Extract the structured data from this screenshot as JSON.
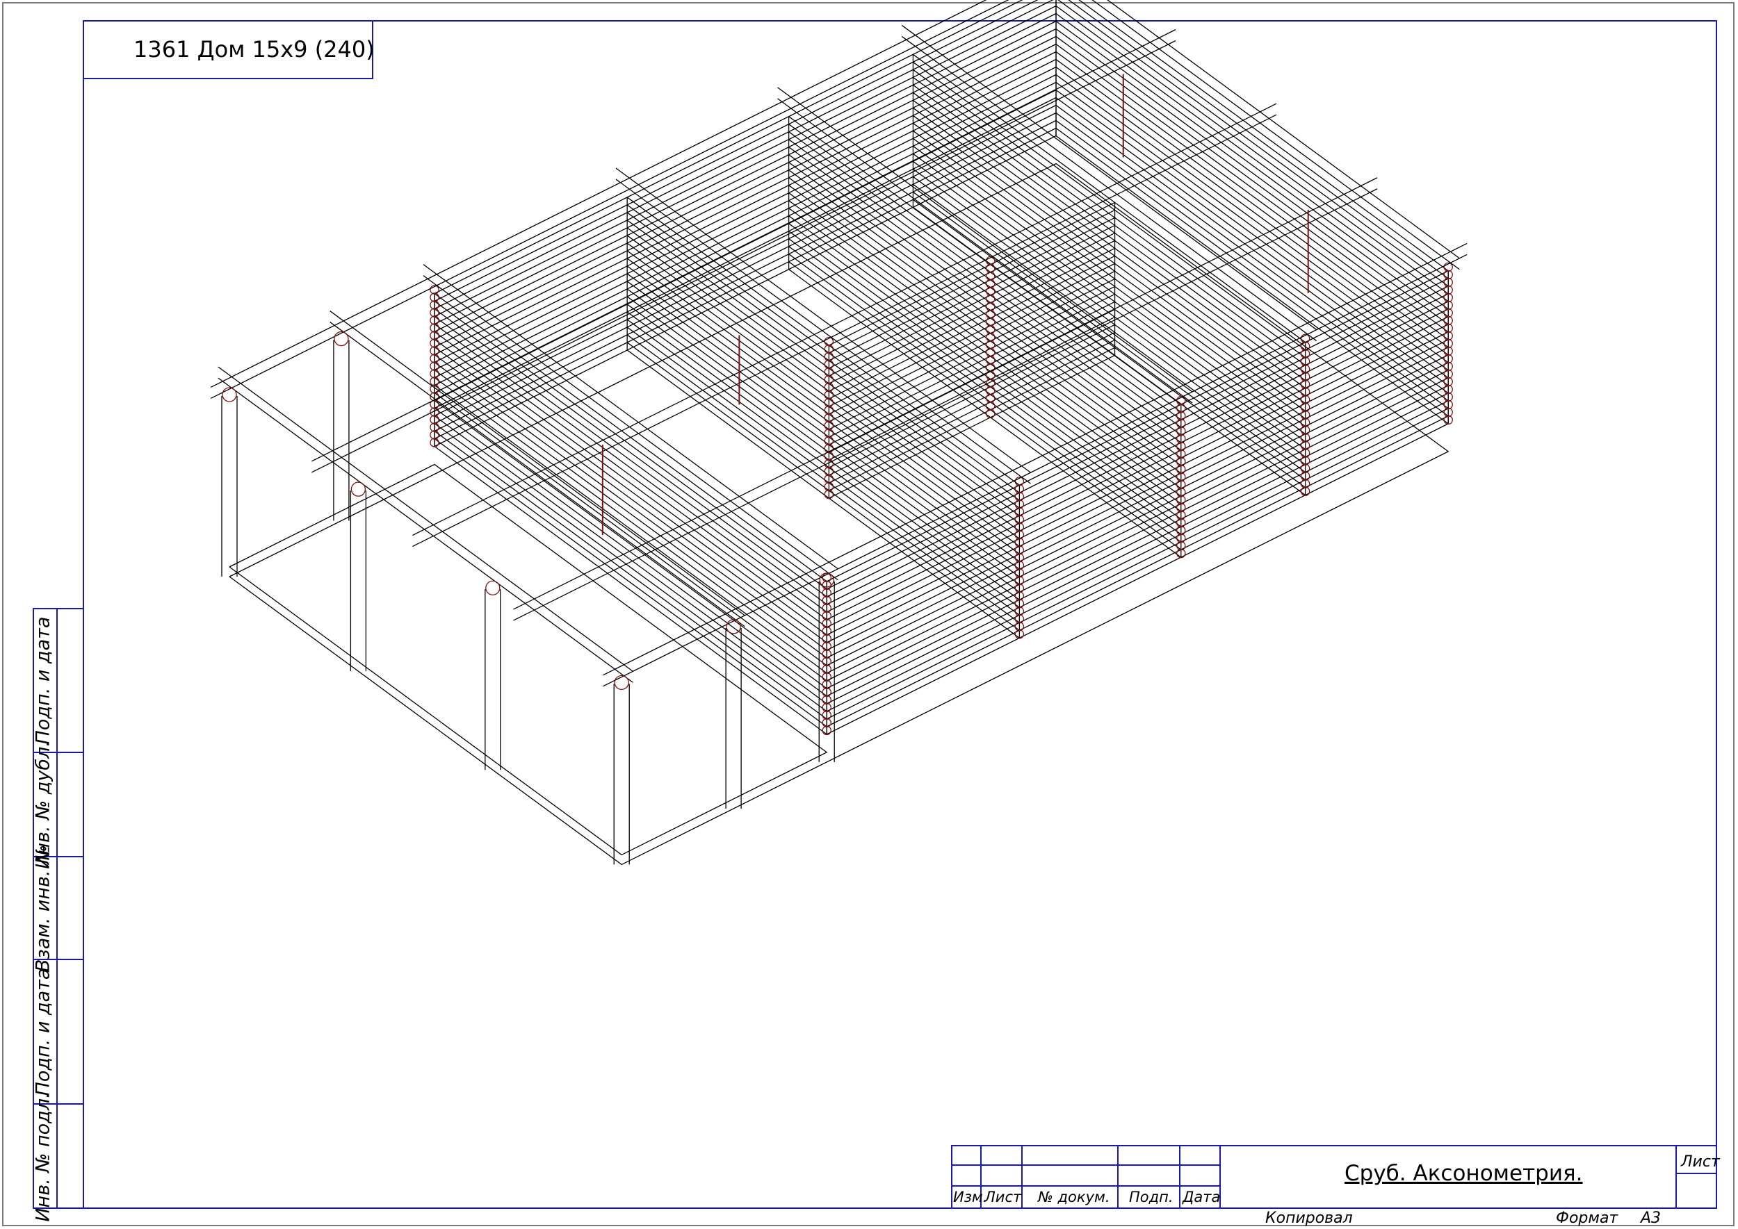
{
  "sheet": {
    "project_title": "1361 Дом 15х9 (240)",
    "drawing_title": "Сруб. Аксонометрия.",
    "copied_label": "Копировал",
    "format_label": "Формат",
    "format_value": "А3",
    "sheet_label": "Лист"
  },
  "side_stamp": {
    "fields": [
      "Подп. и дата",
      "Инв. № дубл.",
      "Взам. инв. №",
      "Подп. и дата",
      "Инв. № подл."
    ]
  },
  "revision_table": {
    "headers": [
      "Изм.",
      "Лист",
      "№ докум.",
      "Подп.",
      "Дата"
    ]
  },
  "colors": {
    "frame": "#1a1aa8",
    "line": "#000000",
    "accent": "#7a1010"
  }
}
